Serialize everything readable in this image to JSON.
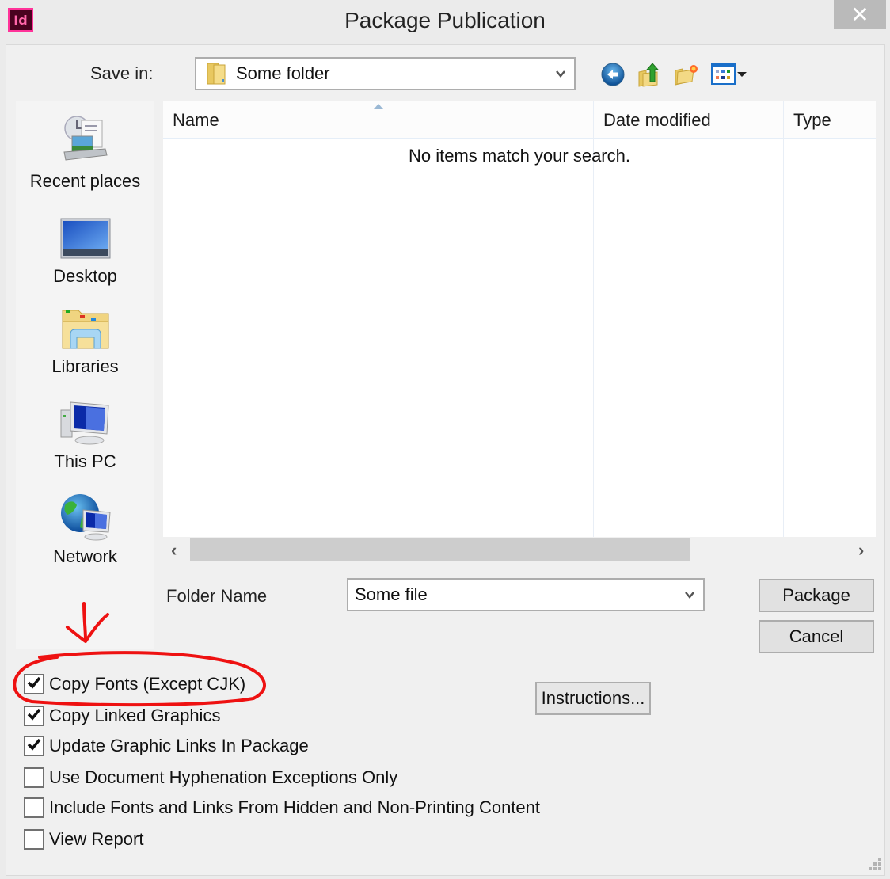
{
  "window": {
    "title": "Package Publication",
    "app_icon_text": "Id",
    "close_glyph": "✕"
  },
  "save_in": {
    "label": "Save in:",
    "value": "Some folder"
  },
  "toolbar": {
    "icons": [
      "back-icon",
      "up-folder-icon",
      "new-folder-icon",
      "view-menu-icon"
    ]
  },
  "places": [
    {
      "label": "Recent places",
      "icon": "recent-places-icon"
    },
    {
      "label": "Desktop",
      "icon": "desktop-icon"
    },
    {
      "label": "Libraries",
      "icon": "libraries-icon"
    },
    {
      "label": "This PC",
      "icon": "this-pc-icon"
    },
    {
      "label": "Network",
      "icon": "network-icon"
    }
  ],
  "file_list": {
    "columns": [
      "Name",
      "Date modified",
      "Type"
    ],
    "sort_column": "Name",
    "sort_direction": "ascending",
    "empty_message": "No items match your search.",
    "scroll_arrows": {
      "left": "‹",
      "right": "›"
    }
  },
  "folder_name": {
    "label": "Folder Name",
    "value": "Some file"
  },
  "buttons": {
    "package": "Package",
    "cancel": "Cancel",
    "instructions": "Instructions..."
  },
  "options": [
    {
      "label": "Copy Fonts (Except CJK)",
      "checked": true
    },
    {
      "label": "Copy Linked Graphics",
      "checked": true
    },
    {
      "label": "Update Graphic Links In Package",
      "checked": true
    },
    {
      "label": "Use Document Hyphenation Exceptions Only",
      "checked": false
    },
    {
      "label": "Include Fonts and Links From Hidden and Non-Printing Content",
      "checked": false
    },
    {
      "label": "View Report",
      "checked": false
    }
  ],
  "annotation": {
    "color": "#ee1111",
    "highlighted_option": "Copy Fonts (Except CJK)"
  }
}
